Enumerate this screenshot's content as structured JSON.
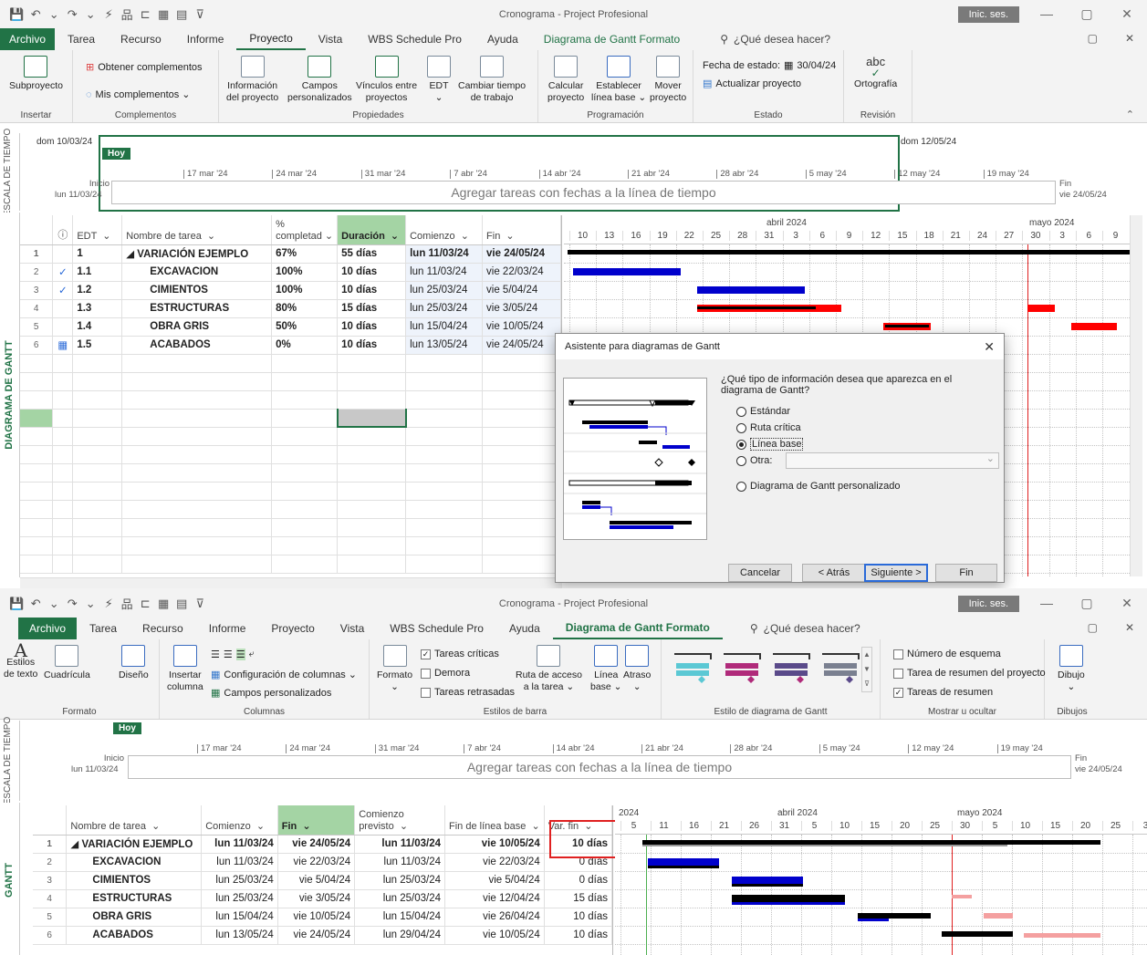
{
  "window": {
    "title": "Cronograma  -  Project Profesional",
    "signin": "Inic. ses.",
    "controls": [
      "—",
      "▢",
      "✕"
    ]
  },
  "qat": [
    "💾",
    "↶",
    "⌄",
    "↷",
    "⌄",
    "⚡",
    "品",
    "⊏",
    "▦",
    "▤",
    "⊽"
  ],
  "menu1": {
    "tabs": [
      "Archivo",
      "Tarea",
      "Recurso",
      "Informe",
      "Proyecto",
      "Vista",
      "WBS Schedule Pro",
      "Ayuda",
      "Diagrama de Gantt  Formato"
    ],
    "tell": "¿Qué desea hacer?"
  },
  "ribbon1": {
    "subproyecto": "Subproyecto",
    "obtener": "Obtener complementos",
    "mis": "Mis complementos  ⌄",
    "info": "Información\ndel proyecto",
    "campos": "Campos\npersonalizados",
    "vinculos": "Vínculos entre\nproyectos",
    "edt": "EDT\n⌄",
    "cambiar": "Cambiar tiempo\nde trabajo",
    "calcular": "Calcular\nproyecto",
    "establecer": "Establecer\nlínea base ⌄",
    "mover": "Mover\nproyecto",
    "fecha_estado_label": "Fecha de estado:",
    "fecha_estado": "30/04/24",
    "actualizar": "Actualizar proyecto",
    "ortografia_icon": "abc",
    "ortografia": "Ortografía",
    "groups": [
      "Insertar",
      "Complementos",
      "Propiedades",
      "Programación",
      "Estado",
      "Revisión"
    ]
  },
  "timeline1": {
    "side": "ESCALA DE TIEMPO",
    "left_date": "dom 10/03/24",
    "right_date": "dom 12/05/24",
    "hoy": "Hoy",
    "inicio": "Inicio",
    "inicio_date": "lun 11/03/24",
    "fin": "Fin",
    "fin_date": "vie 24/05/24",
    "placeholder": "Agregar tareas con fechas a la línea de tiempo",
    "ticks": [
      "17 mar '24",
      "24 mar '24",
      "31 mar '24",
      "7 abr '24",
      "14 abr '24",
      "21 abr '24",
      "28 abr '24",
      "5 may '24",
      "12 may '24",
      "19 may '24"
    ]
  },
  "grid1": {
    "side": "DIAGRAMA DE GANTT",
    "headers": [
      "",
      "ⓘ",
      "EDT  ⌄",
      "Nombre de tarea  ⌄",
      "%\ncompletad ⌄",
      "Duración  ⌄",
      "Comienzo  ⌄",
      "Fin  ⌄"
    ],
    "rows": [
      {
        "n": "1",
        "i": "",
        "edt": "1",
        "name": "◢ VARIACIÓN EJEMPLO",
        "pct": "67%",
        "dur": "55 días",
        "start": "lun 11/03/24",
        "end": "vie 24/05/24"
      },
      {
        "n": "2",
        "i": "✓",
        "edt": "1.1",
        "name": "EXCAVACION",
        "pct": "100%",
        "dur": "10 días",
        "start": "lun 11/03/24",
        "end": "vie 22/03/24"
      },
      {
        "n": "3",
        "i": "✓",
        "edt": "1.2",
        "name": "CIMIENTOS",
        "pct": "100%",
        "dur": "10 días",
        "start": "lun 25/03/24",
        "end": "vie 5/04/24"
      },
      {
        "n": "4",
        "i": "",
        "edt": "1.3",
        "name": "ESTRUCTURAS",
        "pct": "80%",
        "dur": "15 días",
        "start": "lun 25/03/24",
        "end": "vie 3/05/24"
      },
      {
        "n": "5",
        "i": "",
        "edt": "1.4",
        "name": "OBRA GRIS",
        "pct": "50%",
        "dur": "10 días",
        "start": "lun 15/04/24",
        "end": "vie 10/05/24"
      },
      {
        "n": "6",
        "i": "▦",
        "edt": "1.5",
        "name": "ACABADOS",
        "pct": "0%",
        "dur": "10 días",
        "start": "lun 13/05/24",
        "end": "vie 24/05/24"
      }
    ]
  },
  "gantt1": {
    "months": [
      "abril 2024",
      "mayo 2024"
    ],
    "days": [
      "10",
      "13",
      "16",
      "19",
      "22",
      "25",
      "28",
      "31",
      "3",
      "6",
      "9",
      "12",
      "15",
      "18",
      "21",
      "24",
      "27",
      "30",
      "3",
      "6",
      "9"
    ]
  },
  "dialog": {
    "title": "Asistente para diagramas de Gantt",
    "close": "✕",
    "question": "¿Qué tipo de información desea que aparezca en el diagrama de Gantt?",
    "options": [
      "Estándar",
      "Ruta crítica",
      "Línea base",
      "Otra:",
      "Diagrama de Gantt personalizado"
    ],
    "selected_option": "Línea base",
    "buttons": [
      "Cancelar",
      "< Atrás",
      "Siguiente >",
      "Fin"
    ]
  },
  "menu2": {
    "tabs": [
      "Archivo",
      "Tarea",
      "Recurso",
      "Informe",
      "Proyecto",
      "Vista",
      "WBS Schedule Pro",
      "Ayuda",
      "Diagrama de Gantt  Formato"
    ],
    "tell": "¿Qué desea hacer?"
  },
  "ribbon2": {
    "estilos_texto": "Estilos\nde texto",
    "cuadricula": "Cuadrícula",
    "diseno": "Diseño",
    "insertar_columna": "Insertar\ncolumna",
    "config_columnas": "Configuración de columnas ⌄",
    "campos_pers": "Campos personalizados",
    "formato": "Formato\n⌄",
    "tareas_criticas": "Tareas críticas",
    "demora": "Demora",
    "tareas_retrasadas": "Tareas retrasadas",
    "ruta_acceso": "Ruta de acceso\na la tarea ⌄",
    "linea_base": "Línea\nbase ⌄",
    "atraso": "Atraso\n⌄",
    "numero_esquema": "Número de esquema",
    "tarea_resumen_proyecto": "Tarea de resumen del proyecto",
    "tareas_resumen": "Tareas de resumen",
    "dibujo": "Dibujo\n⌄",
    "groups": [
      "Formato",
      "Columnas",
      "Estilos de barra",
      "Estilo de diagrama de Gantt",
      "Mostrar u ocultar",
      "Dibujos"
    ]
  },
  "timeline2": {
    "side": "ESCALA DE TIEMPO",
    "hoy": "Hoy",
    "inicio": "Inicio",
    "inicio_date": "lun 11/03/24",
    "fin": "Fin",
    "fin_date": "vie 24/05/24",
    "placeholder": "Agregar tareas con fechas a la línea de tiempo",
    "ticks": [
      "17 mar '24",
      "24 mar '24",
      "31 mar '24",
      "7 abr '24",
      "14 abr '24",
      "21 abr '24",
      "28 abr '24",
      "5 may '24",
      "12 may '24",
      "19 may '24"
    ]
  },
  "grid2": {
    "side": "GANTT",
    "headers": [
      "",
      "Nombre de tarea  ⌄",
      "Comienzo  ⌄",
      "Fin  ⌄",
      "Comienzo\nprevisto  ⌄",
      "Fin de línea base  ⌄",
      "Var. fin  ⌄"
    ],
    "rows": [
      {
        "n": "1",
        "name": "◢ VARIACIÓN EJEMPLO",
        "start": "lun 11/03/24",
        "end": "vie 24/05/24",
        "bstart": "lun 11/03/24",
        "bend": "vie 10/05/24",
        "var": "10 días"
      },
      {
        "n": "2",
        "name": "EXCAVACION",
        "start": "lun 11/03/24",
        "end": "vie 22/03/24",
        "bstart": "lun 11/03/24",
        "bend": "vie 22/03/24",
        "var": "0 días"
      },
      {
        "n": "3",
        "name": "CIMIENTOS",
        "start": "lun 25/03/24",
        "end": "vie 5/04/24",
        "bstart": "lun 25/03/24",
        "bend": "vie 5/04/24",
        "var": "0 días"
      },
      {
        "n": "4",
        "name": "ESTRUCTURAS",
        "start": "lun 25/03/24",
        "end": "vie 3/05/24",
        "bstart": "lun 25/03/24",
        "bend": "vie 12/04/24",
        "var": "15 días"
      },
      {
        "n": "5",
        "name": "OBRA GRIS",
        "start": "lun 15/04/24",
        "end": "vie 10/05/24",
        "bstart": "lun 15/04/24",
        "bend": "vie 26/04/24",
        "var": "10 días"
      },
      {
        "n": "6",
        "name": "ACABADOS",
        "start": "lun 13/05/24",
        "end": "vie 24/05/24",
        "bstart": "lun 29/04/24",
        "bend": "vie 10/05/24",
        "var": "10 días"
      }
    ]
  },
  "gantt2": {
    "year": "2024",
    "months": [
      "abril 2024",
      "mayo 2024"
    ],
    "days": [
      "5",
      "11",
      "16",
      "21",
      "26",
      "31",
      "5",
      "10",
      "15",
      "20",
      "25",
      "30",
      "5",
      "10",
      "15",
      "20",
      "25",
      "3"
    ]
  },
  "colors": {
    "accent": "#217346",
    "progress_blue": "#0000cc",
    "critical_red": "#ff0000",
    "baseline_pink": "#f4a0a0",
    "status_line": "#e02020"
  }
}
